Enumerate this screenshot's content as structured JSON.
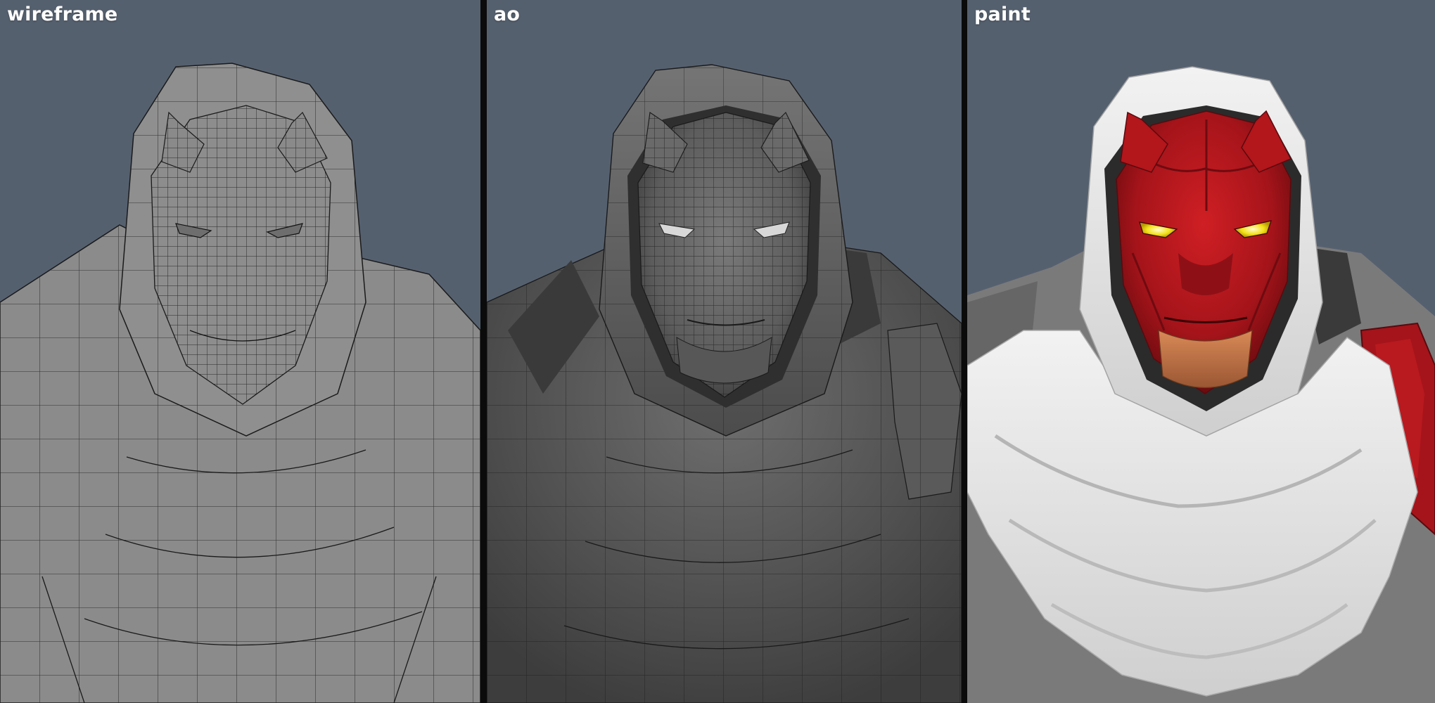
{
  "panels": [
    {
      "label": "wireframe",
      "subject": "3d-character-bust",
      "shading": "wireframe"
    },
    {
      "label": "ao",
      "subject": "3d-character-bust",
      "shading": "ambient-occlusion"
    },
    {
      "label": "paint",
      "subject": "3d-character-bust",
      "shading": "hand-painted"
    }
  ],
  "colors": {
    "background": "#55606f",
    "divider": "#0b0b0b",
    "wire_gray": "#8b8b8b",
    "ao_gray": "#6d6d6d",
    "skin_red": "#b3161b",
    "cloth_white": "#e4e4e4",
    "eye_yellow": "#f3e21a",
    "jaw_skin": "#c4774a"
  }
}
